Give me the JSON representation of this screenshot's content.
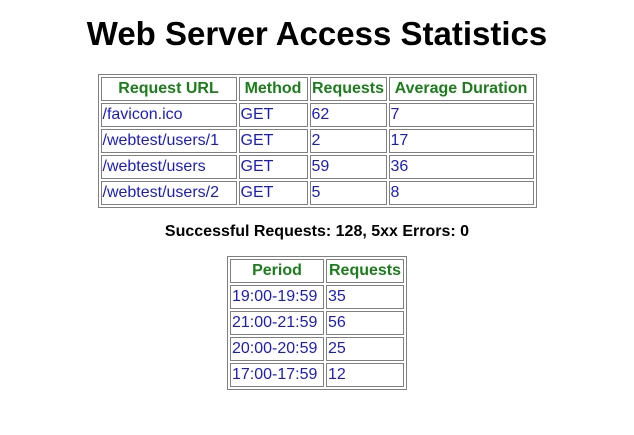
{
  "page": {
    "title": "Web Server Access Statistics"
  },
  "requests_table": {
    "headers": [
      "Request URL",
      "Method",
      "Requests",
      "Average Duration"
    ],
    "rows": [
      [
        "/favicon.ico",
        "GET",
        "62",
        "7"
      ],
      [
        "/webtest/users/1",
        "GET",
        "2",
        "17"
      ],
      [
        "/webtest/users",
        "GET",
        "59",
        "36"
      ],
      [
        "/webtest/users/2",
        "GET",
        "5",
        "8"
      ]
    ]
  },
  "summary": {
    "text": "Successful Requests: 128, 5xx Errors: 0"
  },
  "periods_table": {
    "headers": [
      "Period",
      "Requests"
    ],
    "rows": [
      [
        "19:00-19:59",
        "35"
      ],
      [
        "21:00-21:59",
        "56"
      ],
      [
        "20:00-20:59",
        "25"
      ],
      [
        "17:00-17:59",
        "12"
      ]
    ]
  },
  "colors": {
    "header_text": "#1a7f1a",
    "cell_text": "#1a1acc",
    "border": "#808080"
  }
}
